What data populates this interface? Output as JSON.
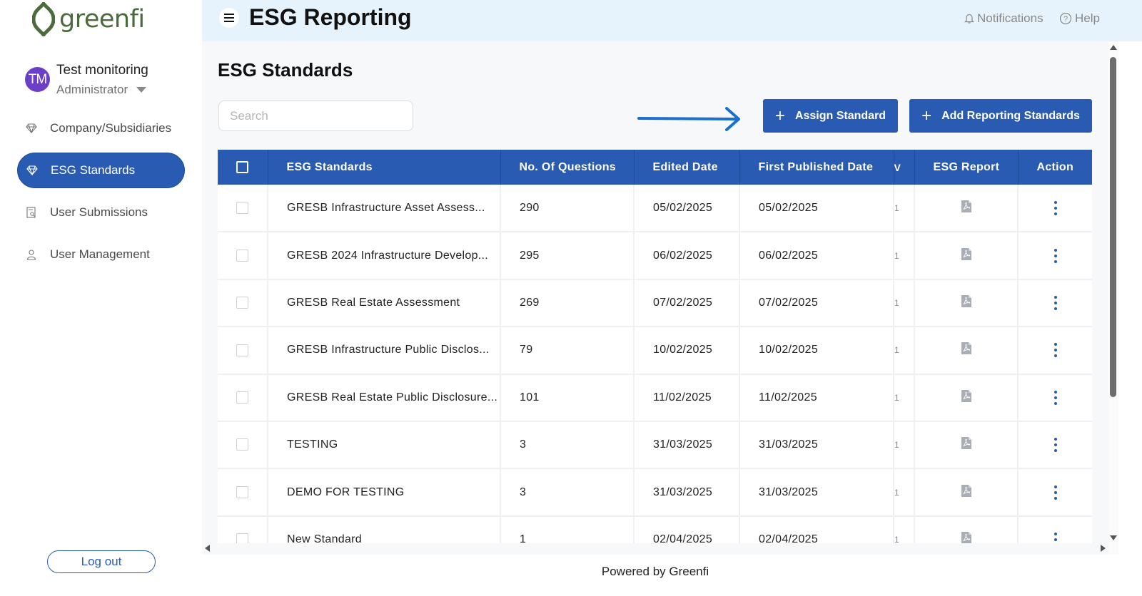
{
  "brand": {
    "name": "greenfi",
    "color": "#4b6b3c"
  },
  "user": {
    "initials": "TM",
    "name": "Test monitoring",
    "role": "Administrator"
  },
  "sidebar": {
    "items": [
      {
        "label": "Company/Subsidiaries",
        "icon": "diamond-icon",
        "active": false
      },
      {
        "label": "ESG Standards",
        "icon": "diamond-icon",
        "active": true
      },
      {
        "label": "User Submissions",
        "icon": "report-search-icon",
        "active": false
      },
      {
        "label": "User Management",
        "icon": "user-icon",
        "active": false
      }
    ],
    "logout_label": "Log out"
  },
  "header": {
    "title": "ESG Reporting",
    "notifications_label": "Notifications",
    "help_label": "Help"
  },
  "main": {
    "page_title": "ESG Standards",
    "search_placeholder": "Search",
    "assign_button": "Assign Standard",
    "add_button": "Add Reporting Standards"
  },
  "table": {
    "headers": {
      "standard": "ESG Standards",
      "questions": "No. Of Questions",
      "edited": "Edited Date",
      "published": "First Published Date",
      "truncated": "V",
      "report": "ESG Report",
      "action": "Action"
    },
    "rows": [
      {
        "name": "GRESB Infrastructure Asset Assess...",
        "questions": "290",
        "edited": "05/02/2025",
        "published": "05/02/2025",
        "truncated": "1"
      },
      {
        "name": "GRESB 2024 Infrastructure Develop...",
        "questions": "295",
        "edited": "06/02/2025",
        "published": "06/02/2025",
        "truncated": "1"
      },
      {
        "name": "GRESB Real Estate Assessment",
        "questions": "269",
        "edited": "07/02/2025",
        "published": "07/02/2025",
        "truncated": "1"
      },
      {
        "name": "GRESB Infrastructure Public Disclos...",
        "questions": "79",
        "edited": "10/02/2025",
        "published": "10/02/2025",
        "truncated": "1"
      },
      {
        "name": "GRESB Real Estate Public Disclosure...",
        "questions": "101",
        "edited": "11/02/2025",
        "published": "11/02/2025",
        "truncated": "1"
      },
      {
        "name": "TESTING",
        "questions": "3",
        "edited": "31/03/2025",
        "published": "31/03/2025",
        "truncated": "1"
      },
      {
        "name": "DEMO FOR TESTING",
        "questions": "3",
        "edited": "31/03/2025",
        "published": "31/03/2025",
        "truncated": "1"
      },
      {
        "name": "New Standard",
        "questions": "1",
        "edited": "02/04/2025",
        "published": "02/04/2025",
        "truncated": "1"
      }
    ]
  },
  "footer": {
    "text": "Powered by Greenfi"
  },
  "colors": {
    "primary": "#2a5bb3",
    "header_bg": "#e6f2fc",
    "avatar": "#6c3fc9"
  }
}
